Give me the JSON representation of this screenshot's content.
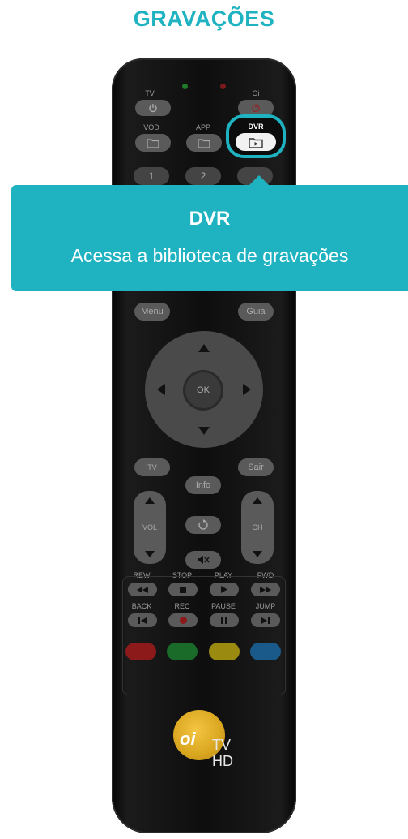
{
  "page_title": "GRAVAÇÕES",
  "tooltip": {
    "title": "DVR",
    "description": "Acessa a biblioteca de gravações"
  },
  "remote": {
    "labels": {
      "tv": "TV",
      "oi": "Oi",
      "vod": "VOD",
      "app": "APP",
      "dvr": "DVR",
      "menu": "Menu",
      "guia": "Guia",
      "ok": "OK",
      "sair": "Sair",
      "info": "Info",
      "vol": "VOL",
      "ch": "CH",
      "rew": "REW",
      "stop": "STOP",
      "play": "PLAY",
      "fwd": "FWD",
      "back": "BACK",
      "rec": "REC",
      "pause": "PAUSE",
      "jump": "JUMP",
      "key1": "1",
      "key2": "2"
    },
    "logo": {
      "brand": "oi",
      "line1": "TV",
      "line2": "HD"
    }
  },
  "colors": {
    "accent": "#1fb3c2",
    "led_green": "#1f7a2a",
    "led_red": "#7a1a1a",
    "red_button": "#8c1a1a",
    "green_button": "#1a6a2a",
    "yellow_button": "#9a8a10",
    "blue_button": "#1a5a8a"
  },
  "icons": [
    "power-icon",
    "folder-icon",
    "play-icon",
    "arrow-up-icon",
    "arrow-down-icon",
    "arrow-left-icon",
    "arrow-right-icon",
    "replay-icon",
    "mute-icon",
    "rewind-icon",
    "stop-icon",
    "forward-icon",
    "skip-back-icon",
    "record-icon",
    "pause-icon",
    "skip-forward-icon"
  ]
}
